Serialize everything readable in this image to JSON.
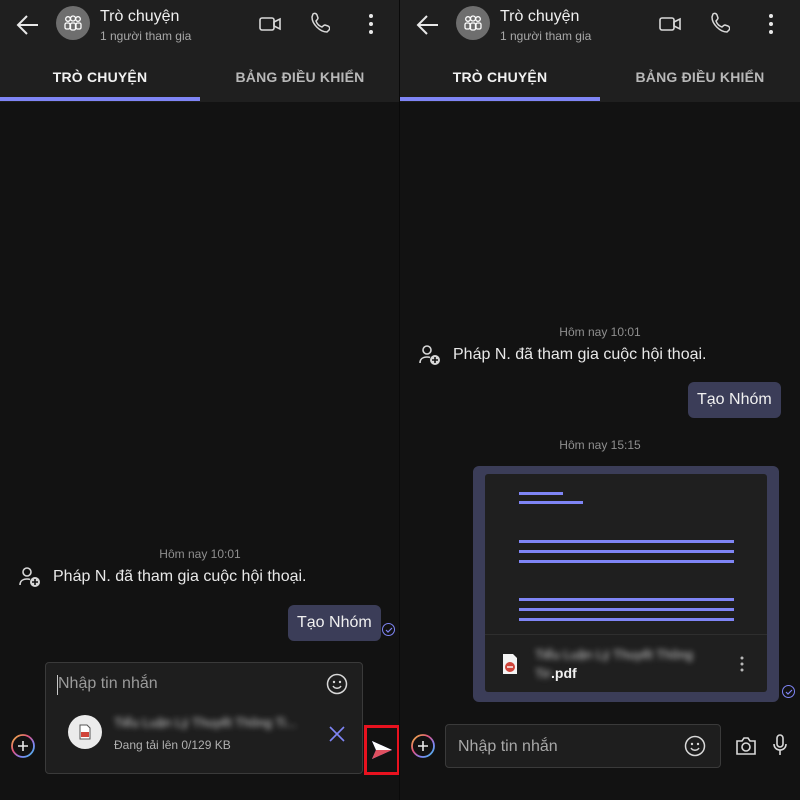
{
  "colors": {
    "accent": "#7f85f5",
    "bubble": "#3b3d58",
    "background": "#121212",
    "header": "#1f1f1f",
    "highlight": "#e8121f"
  },
  "header": {
    "title": "Trò chuyện",
    "subtitle": "1 người tham gia"
  },
  "tabs": {
    "chat": "TRÒ CHUYỆN",
    "dashboard": "BẢNG ĐIỀU KHIỂN"
  },
  "left": {
    "timestamp": "Hôm nay 10:01",
    "system_message": "Pháp N. đã tham gia cuộc hội thoại.",
    "bubble": "Tạo Nhóm",
    "composer": {
      "placeholder": "Nhập tin nhắn",
      "upload_name": "Tiểu Luận Lý Thuyết Thông Ti...",
      "upload_status": "Đang tải lên 0/129 KB"
    }
  },
  "right": {
    "timestamp_1": "Hôm nay 10:01",
    "system_message": "Pháp N. đã tham gia cuộc hội thoại.",
    "bubble": "Tạo Nhóm",
    "timestamp_2": "Hôm nay 15:15",
    "file": {
      "name_blurred_1": "Tiểu Luận Lý Thuyết Thông",
      "name_blurred_2": "Tin 1",
      "ext": ".pdf"
    },
    "composer": {
      "placeholder": "Nhập tin nhắn"
    }
  },
  "icons": {
    "back": "arrow-left-icon",
    "group": "group-avatar-icon",
    "video": "video-call-icon",
    "call": "phone-icon",
    "more": "more-vertical-icon",
    "join": "person-add-icon",
    "emoji": "emoji-icon",
    "pdf": "pdf-file-icon",
    "close": "close-icon",
    "plus": "plus-circle-icon",
    "send": "send-icon",
    "camera": "camera-icon",
    "mic": "microphone-icon",
    "read": "check-circle-icon"
  }
}
